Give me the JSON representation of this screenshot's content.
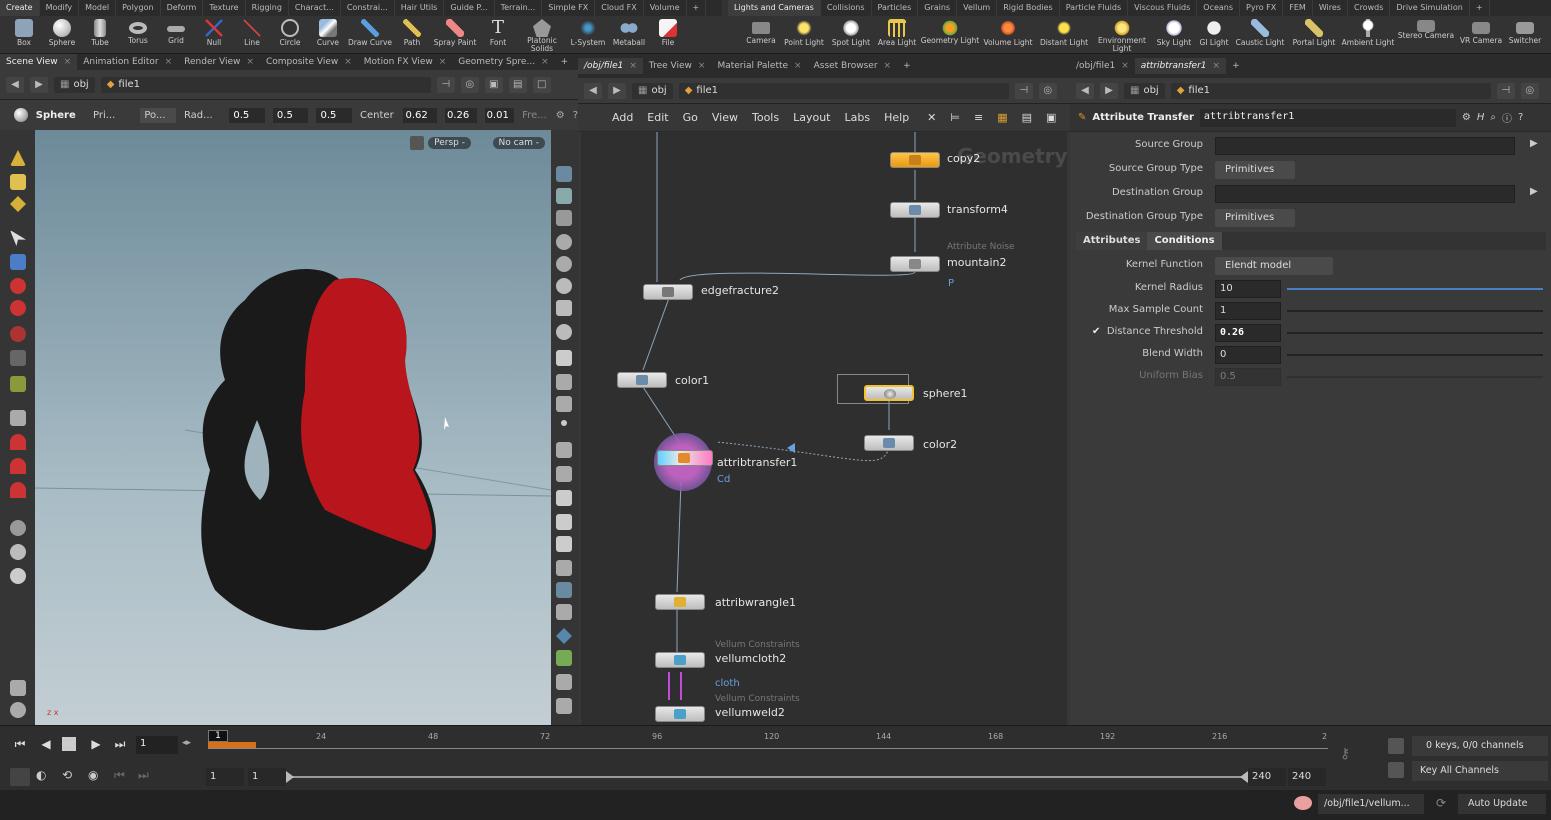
{
  "shelf": {
    "left_tabs": [
      "Create",
      "Modify",
      "Model",
      "Polygon",
      "Deform",
      "Texture",
      "Rigging",
      "Charact...",
      "Constrai...",
      "Hair Utils",
      "Guide P...",
      "Terrain...",
      "Simple FX",
      "Cloud FX",
      "Volume"
    ],
    "left_tools": [
      "Box",
      "Sphere",
      "Tube",
      "Torus",
      "Grid",
      "Null",
      "Line",
      "Circle",
      "Curve",
      "Draw Curve",
      "Path",
      "Spray Paint",
      "Font",
      "Platonic Solids",
      "L-System",
      "Metaball",
      "File"
    ],
    "right_tabs": [
      "Lights and Cameras",
      "Collisions",
      "Particles",
      "Grains",
      "Vellum",
      "Rigid Bodies",
      "Particle Fluids",
      "Viscous Fluids",
      "Oceans",
      "Pyro FX",
      "FEM",
      "Wires",
      "Crowds",
      "Drive Simulation"
    ],
    "right_tools": [
      "Camera",
      "Point Light",
      "Spot Light",
      "Area Light",
      "Geometry Light",
      "Volume Light",
      "Distant Light",
      "Environment Light",
      "Sky Light",
      "GI Light",
      "Caustic Light",
      "Portal Light",
      "Ambient Light",
      "Stereo Camera",
      "VR Camera",
      "Switcher"
    ],
    "plus": "+"
  },
  "viewport": {
    "tabs": [
      "Scene View",
      "Animation Editor",
      "Render View",
      "Composite View",
      "Motion FX View",
      "Geometry Spre..."
    ],
    "path_obj": "obj",
    "path_file": "file1",
    "op_name": "Sphere",
    "op_primitive": "Pri...",
    "op_mode": "Po...",
    "op_rad_label": "Rad...",
    "rad": [
      "0.5",
      "0.5",
      "0.5"
    ],
    "center_label": "Center",
    "center": [
      "0.62",
      "0.26",
      "0.01"
    ],
    "freq_label": "Fre...",
    "persp": "Persp -",
    "cam": "No cam -",
    "axes_label": "z x"
  },
  "network": {
    "tabs": [
      "/obj/file1",
      "Tree View",
      "Material Palette",
      "Asset Browser"
    ],
    "path_obj": "obj",
    "path_file": "file1",
    "menu": [
      "Add",
      "Edit",
      "Go",
      "View",
      "Tools",
      "Layout",
      "Labs",
      "Help"
    ],
    "watermark": "Geometry",
    "nodes": {
      "copy2": "copy2",
      "transform4": "transform4",
      "mountain2_type": "Attribute Noise",
      "mountain2": "mountain2",
      "mountain2_attr": "P",
      "edgefracture2": "edgefracture2",
      "color1": "color1",
      "sphere1": "sphere1",
      "color2": "color2",
      "attribtransfer1": "attribtransfer1",
      "attribtransfer1_attr": "Cd",
      "attribwrangle1": "attribwrangle1",
      "vellumcloth2_type": "Vellum Constraints",
      "vellumcloth2": "vellumcloth2",
      "vellumcloth2_attr": "cloth",
      "vellumweld2_type": "Vellum Constraints",
      "vellumweld2": "vellumweld2"
    }
  },
  "params": {
    "tabs": [
      "/obj/file1",
      "attribtransfer1"
    ],
    "path_obj": "obj",
    "path_file": "file1",
    "node_type": "Attribute Transfer",
    "node_name": "attribtransfer1",
    "source_group_label": "Source Group",
    "source_group_type_label": "Source Group Type",
    "source_group_type": "Primitives",
    "dest_group_label": "Destination Group",
    "dest_group_type_label": "Destination Group Type",
    "dest_group_type": "Primitives",
    "subtabs": [
      "Attributes",
      "Conditions"
    ],
    "kernel_function_label": "Kernel Function",
    "kernel_function": "Elendt model",
    "kernel_radius_label": "Kernel Radius",
    "kernel_radius": "10",
    "max_sample_label": "Max Sample Count",
    "max_sample": "1",
    "distance_threshold_label": "Distance Threshold",
    "distance_threshold": "0.26",
    "blend_width_label": "Blend Width",
    "blend_width": "0",
    "uniform_bias_label": "Uniform Bias",
    "uniform_bias": "0.5"
  },
  "timeline": {
    "current_frame": "1",
    "frame_marker": "1",
    "ticks": [
      "24",
      "48",
      "72",
      "96",
      "120",
      "144",
      "168",
      "192",
      "216",
      "2"
    ],
    "range_start": "1",
    "range_start2": "1",
    "range_end": "240",
    "range_end2": "240",
    "keys": "0 keys, 0/0 channels",
    "key_all": "Key All Channels",
    "status_path": "/obj/file1/vellum...",
    "auto_update": "Auto Update"
  },
  "colors": {
    "accent_orange": "#f0a020",
    "selected_yellow": "#f2c12e",
    "red_geo": "#b8161c",
    "link_blue": "#6aa0e0"
  }
}
